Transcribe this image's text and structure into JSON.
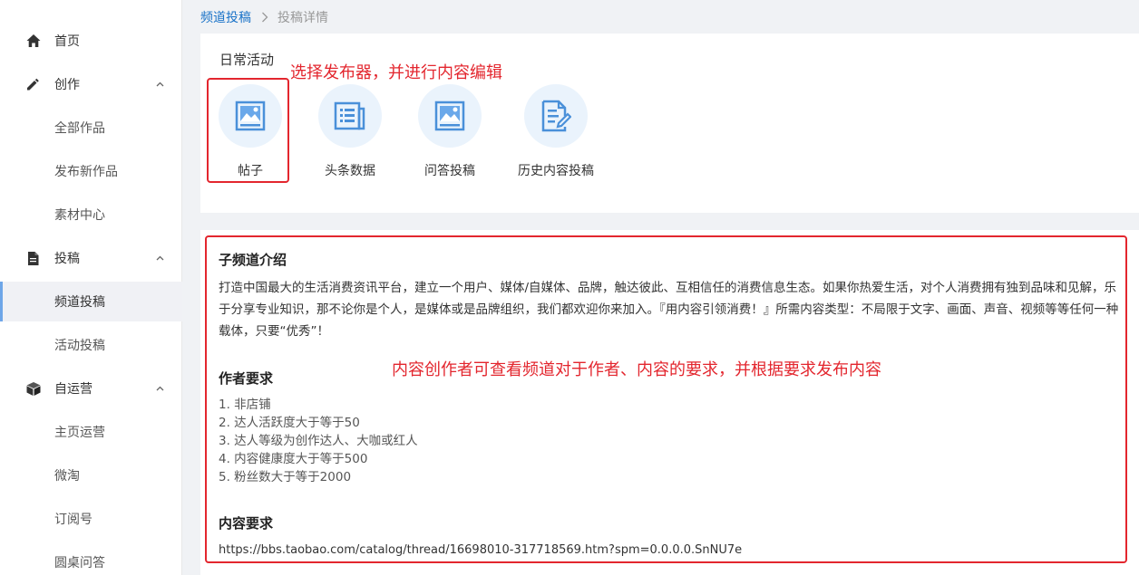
{
  "sidebar": {
    "items": [
      {
        "label": "首页",
        "icon": "home-icon",
        "level": "top"
      },
      {
        "label": "创作",
        "icon": "pencil-icon",
        "level": "top",
        "expanded": true
      },
      {
        "label": "全部作品",
        "level": "sub"
      },
      {
        "label": "发布新作品",
        "level": "sub"
      },
      {
        "label": "素材中心",
        "level": "sub"
      },
      {
        "label": "投稿",
        "icon": "document-icon",
        "level": "top",
        "expanded": true
      },
      {
        "label": "频道投稿",
        "level": "sub",
        "active": true
      },
      {
        "label": "活动投稿",
        "level": "sub"
      },
      {
        "label": "自运营",
        "icon": "box-icon",
        "level": "top",
        "expanded": true
      },
      {
        "label": "主页运营",
        "level": "sub"
      },
      {
        "label": "微淘",
        "level": "sub"
      },
      {
        "label": "订阅号",
        "level": "sub"
      },
      {
        "label": "圆桌问答",
        "level": "sub"
      }
    ]
  },
  "breadcrumb": {
    "parent": "频道投稿",
    "current": "投稿详情"
  },
  "activity": {
    "title": "日常活动",
    "tools": [
      {
        "label": "帖子",
        "icon": "image-icon"
      },
      {
        "label": "头条数据",
        "icon": "news-list-icon"
      },
      {
        "label": "问答投稿",
        "icon": "image-icon"
      },
      {
        "label": "历史内容投稿",
        "icon": "edit-document-icon"
      }
    ]
  },
  "channel": {
    "intro_title": "子频道介绍",
    "intro_text": "打造中国最大的生活消费资讯平台，建立一个用户、媒体/自媒体、品牌，触达彼此、互相信任的消费信息生态。如果你热爱生活，对个人消费拥有独到品味和见解，乐于分享专业知识，那不论你是个人，是媒体或是品牌组织，我们都欢迎你来加入。『用内容引领消费！』所需内容类型：不局限于文字、画面、声音、视频等等任何一种载体，只要“优秀”！",
    "author_title": "作者要求",
    "author_reqs": [
      "1. 非店铺",
      "2. 达人活跃度大于等于50",
      "3. 达人等级为创作达人、大咖或红人",
      "4. 内容健康度大于等于500",
      "5. 粉丝数大于等于2000"
    ],
    "content_title": "内容要求",
    "content_url": "https://bbs.taobao.com/catalog/thread/16698010-317718569.htm?spm=0.0.0.0.SnNU7e"
  },
  "annotations": {
    "top": "选择发布器，并进行内容编辑",
    "middle": "内容创作者可查看频道对于作者、内容的要求，并根据要求发布内容"
  },
  "colors": {
    "accent_blue": "#1a73c8",
    "icon_blue": "#4a90d9",
    "icon_bg": "#eaf3fc",
    "annotation_red": "#e3262e"
  }
}
